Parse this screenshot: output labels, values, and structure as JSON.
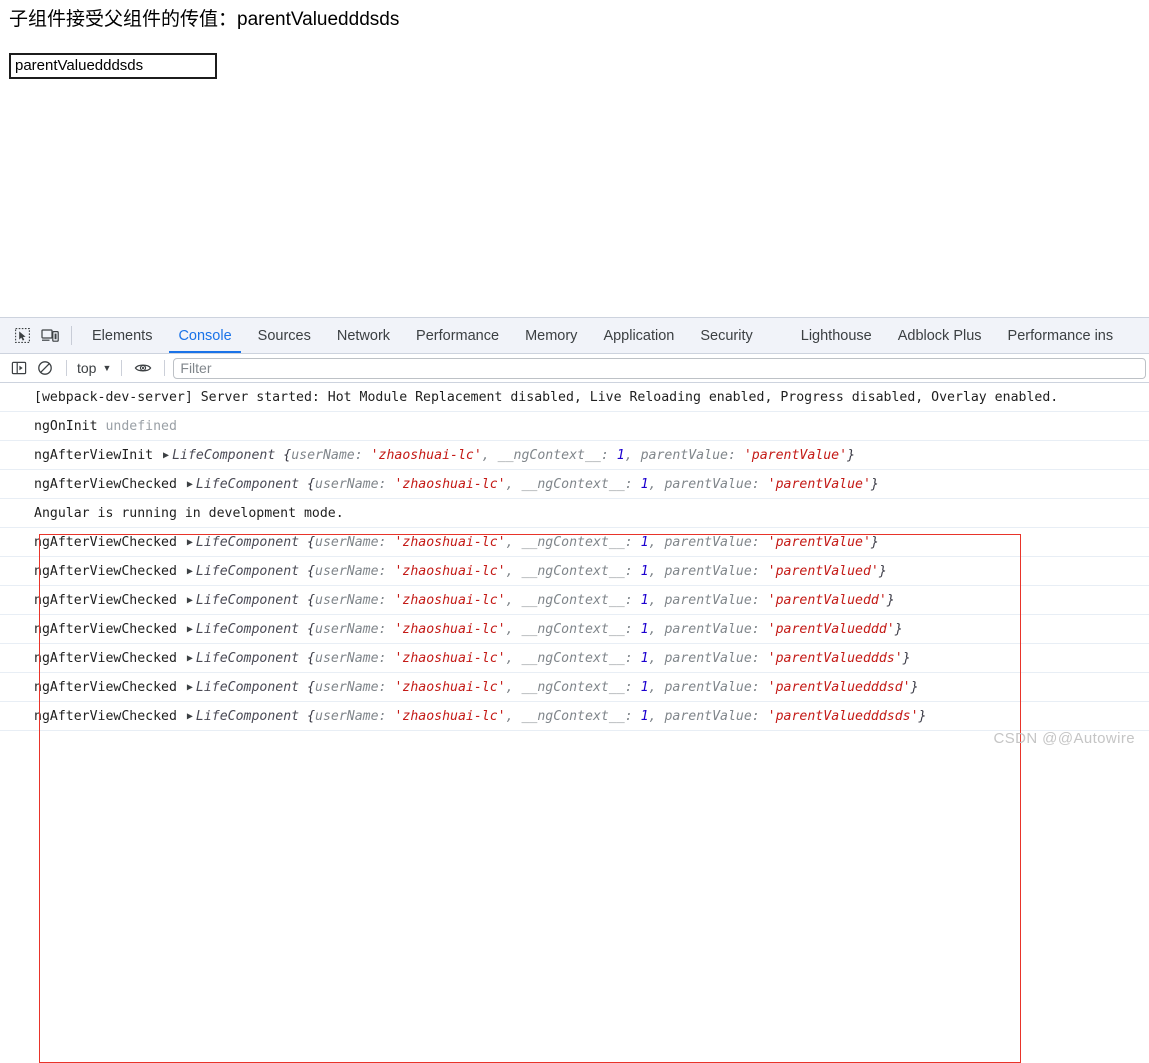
{
  "page": {
    "heading": "子组件接受父组件的传值：parentValuedddsds",
    "input_value": "parentValuedddsds",
    "input_placeholder": ""
  },
  "devtools": {
    "toolbar_icons": [
      {
        "name": "inspect-element-icon"
      },
      {
        "name": "device-toolbar-icon"
      }
    ],
    "tabs": [
      {
        "label": "Elements",
        "active": false
      },
      {
        "label": "Console",
        "active": true
      },
      {
        "label": "Sources",
        "active": false
      },
      {
        "label": "Network",
        "active": false
      },
      {
        "label": "Performance",
        "active": false
      },
      {
        "label": "Memory",
        "active": false
      },
      {
        "label": "Application",
        "active": false
      },
      {
        "label": "Security",
        "active": false
      },
      {
        "label": "Lighthouse",
        "active": false
      },
      {
        "label": "Adblock Plus",
        "active": false
      },
      {
        "label": "Performance ins",
        "active": false
      }
    ],
    "filterbar": {
      "sidebar_toggle_icon": "console-sidebar-icon",
      "clear_console_icon": "clear-console-icon",
      "context_label": "top",
      "context_caret": "▼",
      "eye_icon": "live-expression-eye-icon",
      "filter_placeholder": "Filter",
      "filter_value": ""
    },
    "accent_color": "#1a73e8",
    "annotation_color": "#e8342a"
  },
  "console_rows": [
    {
      "kind": "plain",
      "text": "[webpack-dev-server] Server started: Hot Module Replacement disabled, Live Reloading enabled, Progress disabled, Overlay enabled."
    },
    {
      "kind": "label-dim",
      "label": "ngOnInit",
      "dim": "undefined"
    },
    {
      "kind": "object",
      "label": "ngAfterViewInit",
      "ctor": "LifeComponent",
      "userName": "'zhaoshuai-lc'",
      "ngContext": "1",
      "parentValue": "'parentValue'"
    },
    {
      "kind": "object",
      "label": "ngAfterViewChecked",
      "ctor": "LifeComponent",
      "userName": "'zhaoshuai-lc'",
      "ngContext": "1",
      "parentValue": "'parentValue'"
    },
    {
      "kind": "plain",
      "text": "Angular is running in development mode."
    },
    {
      "kind": "object",
      "label": "ngAfterViewChecked",
      "ctor": "LifeComponent",
      "userName": "'zhaoshuai-lc'",
      "ngContext": "1",
      "parentValue": "'parentValue'"
    },
    {
      "kind": "object",
      "label": "ngAfterViewChecked",
      "ctor": "LifeComponent",
      "userName": "'zhaoshuai-lc'",
      "ngContext": "1",
      "parentValue": "'parentValued'"
    },
    {
      "kind": "object",
      "label": "ngAfterViewChecked",
      "ctor": "LifeComponent",
      "userName": "'zhaoshuai-lc'",
      "ngContext": "1",
      "parentValue": "'parentValuedd'"
    },
    {
      "kind": "object",
      "label": "ngAfterViewChecked",
      "ctor": "LifeComponent",
      "userName": "'zhaoshuai-lc'",
      "ngContext": "1",
      "parentValue": "'parentValueddd'"
    },
    {
      "kind": "object",
      "label": "ngAfterViewChecked",
      "ctor": "LifeComponent",
      "userName": "'zhaoshuai-lc'",
      "ngContext": "1",
      "parentValue": "'parentValueddds'"
    },
    {
      "kind": "object",
      "label": "ngAfterViewChecked",
      "ctor": "LifeComponent",
      "userName": "'zhaoshuai-lc'",
      "ngContext": "1",
      "parentValue": "'parentValuedddsd'"
    },
    {
      "kind": "object",
      "label": "ngAfterViewChecked",
      "ctor": "LifeComponent",
      "userName": "'zhaoshuai-lc'",
      "ngContext": "1",
      "parentValue": "'parentValuedddsds'"
    }
  ],
  "static_tokens": {
    "brace_open": "{",
    "brace_close": "}",
    "key_username": "userName",
    "key_ngcontext": "__ngContext__",
    "key_parentvalue": "parentValue",
    "colon": ": ",
    "comma": ", ",
    "disclosure": "▶"
  },
  "watermark": "CSDN @@Autowire"
}
